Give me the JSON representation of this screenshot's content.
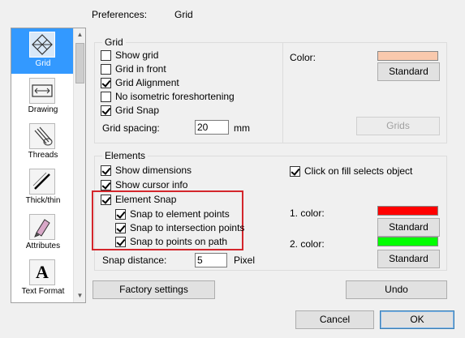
{
  "header": {
    "label": "Preferences:",
    "value": "Grid"
  },
  "sidebar": {
    "items": [
      {
        "label": "Grid",
        "icon": "grid-icon",
        "selected": true
      },
      {
        "label": "Drawing",
        "icon": "drawing-icon",
        "selected": false
      },
      {
        "label": "Threads",
        "icon": "threads-icon",
        "selected": false
      },
      {
        "label": "Thick/thin",
        "icon": "thick-thin-icon",
        "selected": false
      },
      {
        "label": "Attributes",
        "icon": "attributes-icon",
        "selected": false
      },
      {
        "label": "Text Format",
        "icon": "text-format-icon",
        "selected": false
      }
    ]
  },
  "grid_group": {
    "title": "Grid",
    "show_grid": {
      "label": "Show grid",
      "checked": false
    },
    "grid_in_front": {
      "label": "Grid in front",
      "checked": false
    },
    "grid_alignment": {
      "label": "Grid Alignment",
      "checked": true
    },
    "no_iso": {
      "label": "No isometric foreshortening",
      "checked": false
    },
    "grid_snap": {
      "label": "Grid Snap",
      "checked": true
    },
    "spacing_label": "Grid spacing:",
    "spacing_value": "20",
    "spacing_unit": "mm",
    "color_label": "Color:",
    "color_swatch": "#f9c9ad",
    "standard_label": "Standard",
    "grids_label": "Grids"
  },
  "elements_group": {
    "title": "Elements",
    "show_dimensions": {
      "label": "Show dimensions",
      "checked": true
    },
    "show_cursor_info": {
      "label": "Show cursor info",
      "checked": true
    },
    "element_snap": {
      "label": "Element Snap",
      "checked": true
    },
    "snap_element_points": {
      "label": "Snap to element points",
      "checked": true
    },
    "snap_intersection_points": {
      "label": "Snap to intersection points",
      "checked": true
    },
    "snap_points_on_path": {
      "label": "Snap to points on path",
      "checked": true
    },
    "snap_distance_label": "Snap distance:",
    "snap_distance_value": "5",
    "snap_distance_unit": "Pixel",
    "click_fill": {
      "label": "Click on fill selects object",
      "checked": true
    },
    "color1_label": "1. color:",
    "color1_swatch": "#ff0000",
    "color2_label": "2. color:",
    "color2_swatch": "#00ff00",
    "standard1_label": "Standard",
    "standard2_label": "Standard"
  },
  "footer": {
    "factory_label": "Factory settings",
    "undo_label": "Undo",
    "cancel_label": "Cancel",
    "ok_label": "OK"
  },
  "colors": {
    "selection": "#3399ff",
    "highlight_frame": "#d4262c"
  }
}
